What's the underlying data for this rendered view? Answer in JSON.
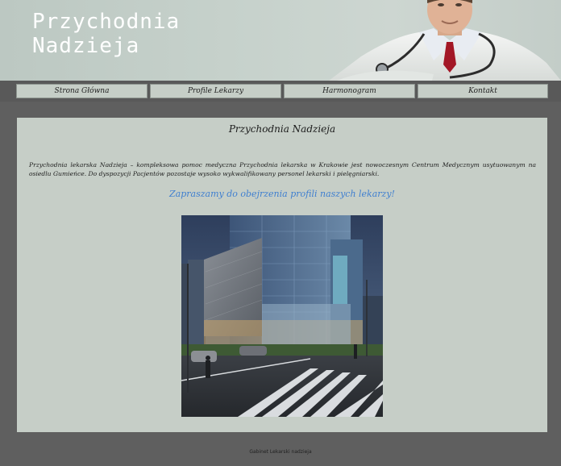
{
  "header": {
    "title": "Przychodnia\nNadzieja"
  },
  "nav": {
    "items": [
      {
        "label": "Strona Główna"
      },
      {
        "label": "Profile Lekarzy"
      },
      {
        "label": "Harmonogram"
      },
      {
        "label": "Kontakt"
      }
    ]
  },
  "main": {
    "title": "Przychodnia Nadzieja",
    "intro": "Przychodnia lekarska Nadzieja – kompleksowa pomoc medyczna Przychodnia lekarska w Krakowie jest nowoczesnym Centrum Medycznym usytuowanym na osiedlu Gumieńce. Do dyspozycji Pacjentów pozostaje wysoko wykwalifikowany personel lekarski i pielęgniarski.",
    "invite_link": "Zapraszamy do obejrzenia profili naszych lekarzy!"
  },
  "footer": {
    "text": "Gabinet Lekarski nadzieja"
  },
  "colors": {
    "page_bg": "#5f5f5f",
    "panel_bg": "#c6cec7",
    "link": "#3f7fd0"
  }
}
